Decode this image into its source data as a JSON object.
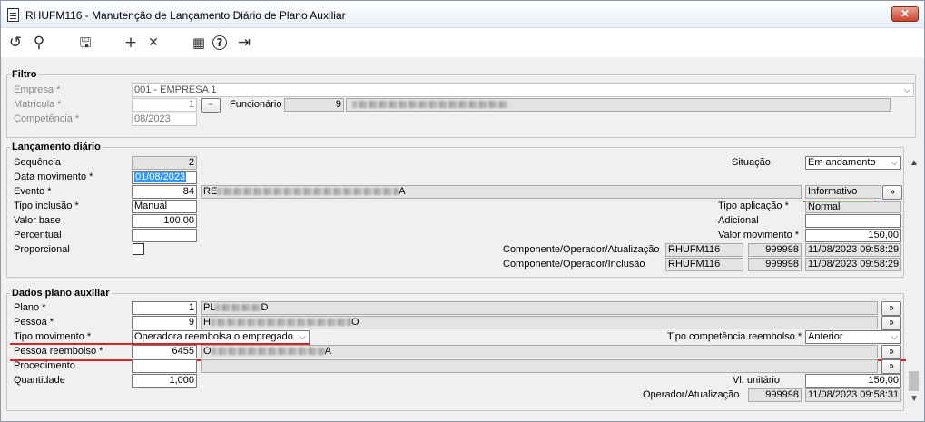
{
  "window": {
    "title": "RHUFM116 - Manutenção de Lançamento Diário de Plano Auxiliar",
    "close_glyph": "✕"
  },
  "toolbar": {
    "undo": "↺",
    "search": "⚲",
    "save": "🖫",
    "add": "+",
    "delete": "✕",
    "calendar": "▦",
    "help": "?",
    "exit": "⇥"
  },
  "filtro": {
    "legend": "Filtro",
    "empresa_label": "Empresa *",
    "empresa_value": "001 - EMPRESA 1",
    "matricula_label": "Matrícula *",
    "matricula_value": "1",
    "funcionario_label": "Funcionário",
    "funcionario_code": "9",
    "funcionario_name": "",
    "competencia_label": "Competência *",
    "competencia_value": "08/2023"
  },
  "lancamento": {
    "legend": "Lançamento diário",
    "sequencia_label": "Sequência",
    "sequencia_value": "2",
    "data_mov_label": "Data movimento *",
    "data_mov_value": "01/08/2023",
    "evento_label": "Evento *",
    "evento_code": "84",
    "evento_desc_start": "RE",
    "evento_desc_end": "A",
    "tipo_inclusao_label": "Tipo inclusão *",
    "tipo_inclusao_value": "Manual",
    "valor_base_label": "Valor base",
    "valor_base_value": "100,00",
    "percentual_label": "Percentual",
    "percentual_value": "",
    "proporcional_label": "Proporcional",
    "situacao_label": "Situação",
    "situacao_value": "Em andamento",
    "informativo_value": "Informativo",
    "tipo_aplicacao_label": "Tipo aplicação *",
    "tipo_aplicacao_value": "Normal",
    "adicional_label": "Adicional",
    "adicional_value": "",
    "valor_mov_label": "Valor movimento *",
    "valor_mov_value": "150,00",
    "comp_atualizacao_label": "Componente/Operador/Atualização",
    "comp_atualizacao_comp": "RHUFM116",
    "comp_atualizacao_op": "999998",
    "comp_atualizacao_dt": "11/08/2023 09:58:29",
    "comp_inclusao_label": "Componente/Operador/Inclusão",
    "comp_inclusao_comp": "RHUFM116",
    "comp_inclusao_op": "999998",
    "comp_inclusao_dt": "11/08/2023 09:58:29"
  },
  "plano": {
    "legend": "Dados plano auxiliar",
    "plano_label": "Plano *",
    "plano_code": "1",
    "plano_desc_start": "PL",
    "plano_desc_end": "D",
    "pessoa_label": "Pessoa *",
    "pessoa_code": "9",
    "pessoa_desc_start": "H",
    "pessoa_desc_end": "O",
    "tipo_mov_label": "Tipo movimento *",
    "tipo_mov_value": "Operadora reembolsa o empregado",
    "tipo_comp_label": "Tipo competência reembolso *",
    "tipo_comp_value": "Anterior",
    "pessoa_reemb_label": "Pessoa reembolso *",
    "pessoa_reemb_code": "6455",
    "pessoa_reemb_desc_start": "O",
    "pessoa_reemb_desc_end": "A",
    "procedimento_label": "Procedimento",
    "procedimento_value": "",
    "quantidade_label": "Quantidade",
    "quantidade_value": "1,000",
    "vl_unitario_label": "Vl. unitário",
    "vl_unitario_value": "150,00",
    "op_atualizacao_label": "Operador/Atualização",
    "op_atualizacao_op": "999998",
    "op_atualizacao_dt": "11/08/2023 09:58:31"
  },
  "lookup_glyph": "»",
  "dropdown_glyph": "⌵",
  "colors": {
    "highlight": "#3399ff",
    "annotation": "#dd2222"
  }
}
